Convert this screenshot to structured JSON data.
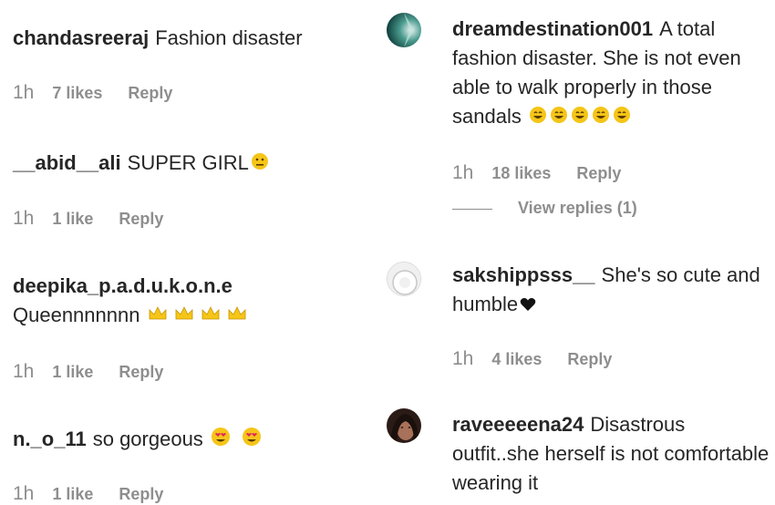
{
  "left_comments": [
    {
      "username": "chandasreeraj",
      "text": "Fashion disaster",
      "time": "1h",
      "likes": "7 likes",
      "reply": "Reply"
    },
    {
      "username": "__abid__ali",
      "text": "SUPER GIRL",
      "time": "1h",
      "likes": "1 like",
      "reply": "Reply",
      "emoji": "neutral-face-emoji"
    },
    {
      "username": "deepika_p.a.d.u.k.o.n.e",
      "text": "Queennnnnnn",
      "time": "1h",
      "likes": "1 like",
      "reply": "Reply",
      "emoji": "crown-emoji"
    },
    {
      "username": "n._o_11",
      "text": "so gorgeous",
      "time": "1h",
      "likes": "1 like",
      "reply": "Reply",
      "emoji": "heart-eyes-emoji"
    }
  ],
  "right_comments": [
    {
      "username": "dreamdestination001",
      "text_line1": "A total",
      "text_rest": "fashion disaster. She is not even able to walk properly in those sandals",
      "time": "1h",
      "likes": "18 likes",
      "reply": "Reply",
      "view_replies": "View replies (1)",
      "emoji": "grinning-face-emoji"
    },
    {
      "username": "sakshippsss__",
      "text": "She's so cute and humble",
      "time": "1h",
      "likes": "4 likes",
      "reply": "Reply",
      "emoji": "black-heart-emoji"
    },
    {
      "username": "raveeeeena24",
      "text_line1": "Disastrous",
      "text_rest": "outfit..she herself is not comfortable wearing it"
    }
  ]
}
